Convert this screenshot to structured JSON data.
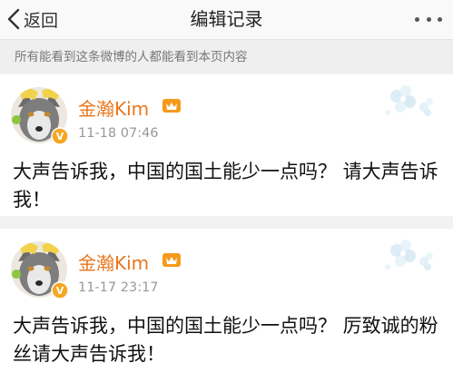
{
  "nav": {
    "back_label": "返回",
    "title": "编辑记录"
  },
  "notice": "所有能看到这条微博的人都能看到本页内容",
  "posts": [
    {
      "username": "金瀚Kim",
      "timestamp": "11-18 07:46",
      "text": "大声告诉我，中国的国土能少一点吗？ 请大声告诉我！"
    },
    {
      "username": "金瀚Kim",
      "timestamp": "11-17 23:17",
      "text": "大声告诉我，中国的国土能少一点吗？ 厉致诚的粉丝请大声告诉我！"
    }
  ],
  "colors": {
    "username": "#e8761c",
    "timestamp": "#999999",
    "verified": "#f5a623",
    "notice_bg": "#efefef"
  },
  "icons": [
    "back-chevron-icon",
    "more-dots-icon",
    "verified-badge-icon",
    "member-crown-icon",
    "flower-decoration-icon"
  ]
}
